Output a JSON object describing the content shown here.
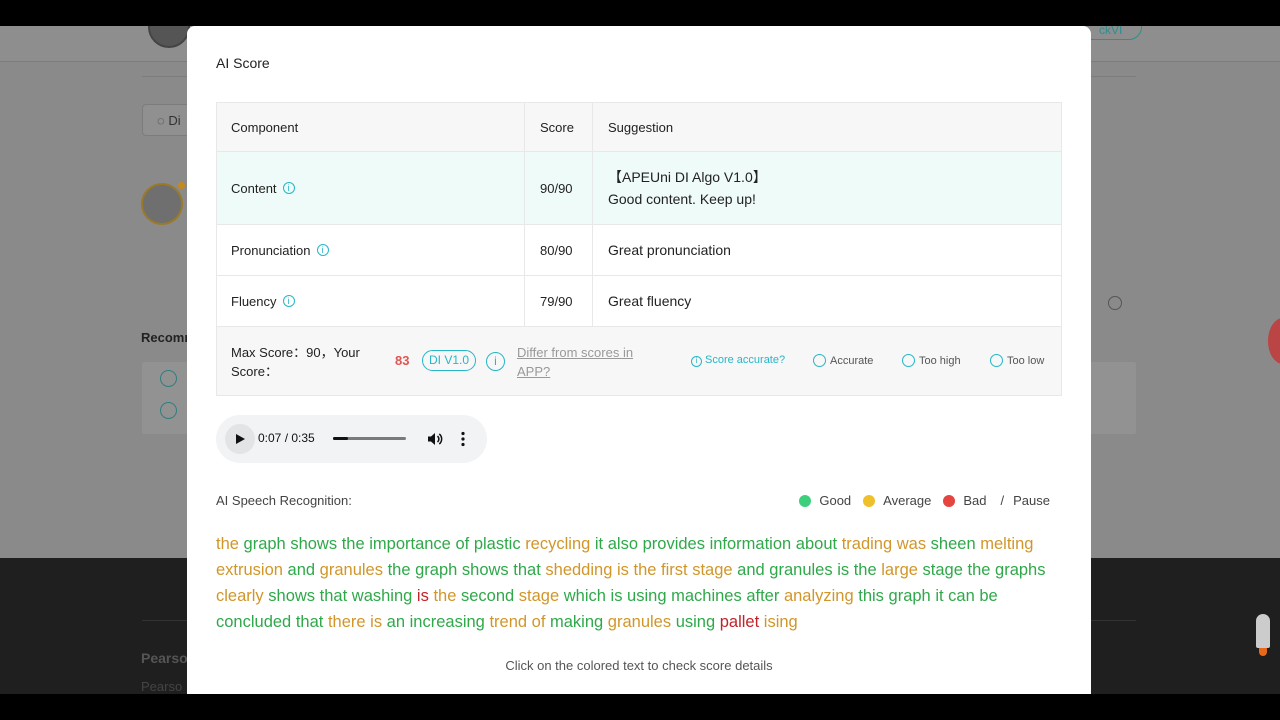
{
  "background": {
    "chip_label": "Di",
    "recommend_label": "Recomm",
    "top_pill_label": "ckVI",
    "footer_title": "Pearso",
    "footer_sub": "Pearso"
  },
  "modal": {
    "title": "AI Score",
    "table": {
      "headers": [
        "Component",
        "Score",
        "Suggestion"
      ],
      "rows": [
        {
          "component": "Content",
          "score": "90/90",
          "suggestion_lines": [
            "【APEUni DI Algo V1.0】",
            "Good content. Keep up!"
          ]
        },
        {
          "component": "Pronunciation",
          "score": "80/90",
          "suggestion_lines": [
            "Great pronunciation"
          ]
        },
        {
          "component": "Fluency",
          "score": "79/90",
          "suggestion_lines": [
            "Great fluency"
          ]
        }
      ]
    },
    "footer": {
      "max_label": "Max Score：90，Your Score：",
      "your_score": "83",
      "algo_badge": "DI V1.0",
      "differ_link": "Differ from scores in APP?",
      "accurate_question": "Score accurate?",
      "options": [
        "Accurate",
        "Too high",
        "Too low"
      ]
    },
    "audio": {
      "time_text": "0:07 / 0:35",
      "progress": 0.2
    },
    "recognition_label": "AI Speech Recognition:",
    "legend": {
      "good": "Good",
      "average": "Average",
      "bad": "Bad",
      "separator": "/",
      "pause": "Pause",
      "colors": {
        "good": "#3ecf7c",
        "average": "#f0c02a",
        "bad": "#e5443f"
      }
    },
    "transcript": [
      {
        "t": "the",
        "q": "a"
      },
      {
        "t": "graph",
        "q": "g"
      },
      {
        "t": "shows",
        "q": "g"
      },
      {
        "t": "the",
        "q": "g"
      },
      {
        "t": "importance",
        "q": "g"
      },
      {
        "t": "of",
        "q": "g"
      },
      {
        "t": "plastic",
        "q": "g"
      },
      {
        "t": "recycling",
        "q": "a"
      },
      {
        "t": "it",
        "q": "g"
      },
      {
        "t": "also",
        "q": "g"
      },
      {
        "t": "provides",
        "q": "g"
      },
      {
        "t": "information",
        "q": "g"
      },
      {
        "t": "about",
        "q": "g"
      },
      {
        "t": "trading",
        "q": "a"
      },
      {
        "t": "was",
        "q": "a"
      },
      {
        "t": "sheen",
        "q": "g"
      },
      {
        "t": "melting",
        "q": "a"
      },
      {
        "t": "extrusion",
        "q": "a"
      },
      {
        "t": "and",
        "q": "g"
      },
      {
        "t": "granules",
        "q": "a"
      },
      {
        "t": "the",
        "q": "g"
      },
      {
        "t": "graph",
        "q": "g"
      },
      {
        "t": "shows",
        "q": "g"
      },
      {
        "t": "that",
        "q": "g"
      },
      {
        "t": "shedding",
        "q": "a"
      },
      {
        "t": "is",
        "q": "a"
      },
      {
        "t": "the",
        "q": "a"
      },
      {
        "t": "first",
        "q": "a"
      },
      {
        "t": "stage",
        "q": "a"
      },
      {
        "t": "and",
        "q": "g"
      },
      {
        "t": "granules",
        "q": "g"
      },
      {
        "t": "is",
        "q": "g"
      },
      {
        "t": "the",
        "q": "g"
      },
      {
        "t": "large",
        "q": "a"
      },
      {
        "t": "stage",
        "q": "g"
      },
      {
        "t": "the",
        "q": "g"
      },
      {
        "t": "graphs",
        "q": "g"
      },
      {
        "t": "clearly",
        "q": "a"
      },
      {
        "t": "shows",
        "q": "g"
      },
      {
        "t": "that",
        "q": "g"
      },
      {
        "t": "washing",
        "q": "g"
      },
      {
        "t": "is",
        "q": "b"
      },
      {
        "t": "the",
        "q": "a"
      },
      {
        "t": "second",
        "q": "g"
      },
      {
        "t": "stage",
        "q": "a"
      },
      {
        "t": "which",
        "q": "g"
      },
      {
        "t": "is",
        "q": "g"
      },
      {
        "t": "using",
        "q": "g"
      },
      {
        "t": "machines",
        "q": "g"
      },
      {
        "t": "after",
        "q": "g"
      },
      {
        "t": "analyzing",
        "q": "a"
      },
      {
        "t": "this",
        "q": "g"
      },
      {
        "t": "graph",
        "q": "g"
      },
      {
        "t": "it",
        "q": "g"
      },
      {
        "t": "can",
        "q": "g"
      },
      {
        "t": "be",
        "q": "g"
      },
      {
        "t": "concluded",
        "q": "g"
      },
      {
        "t": "that",
        "q": "g"
      },
      {
        "t": "there",
        "q": "a"
      },
      {
        "t": "is",
        "q": "a"
      },
      {
        "t": "an",
        "q": "g"
      },
      {
        "t": "increasing",
        "q": "g"
      },
      {
        "t": "trend",
        "q": "a"
      },
      {
        "t": "of",
        "q": "a"
      },
      {
        "t": "making",
        "q": "g"
      },
      {
        "t": "granules",
        "q": "a"
      },
      {
        "t": "using",
        "q": "g"
      },
      {
        "t": "pallet",
        "q": "b"
      },
      {
        "t": "ising",
        "q": "a"
      }
    ],
    "hint": "Click on the colored text to check score details"
  }
}
